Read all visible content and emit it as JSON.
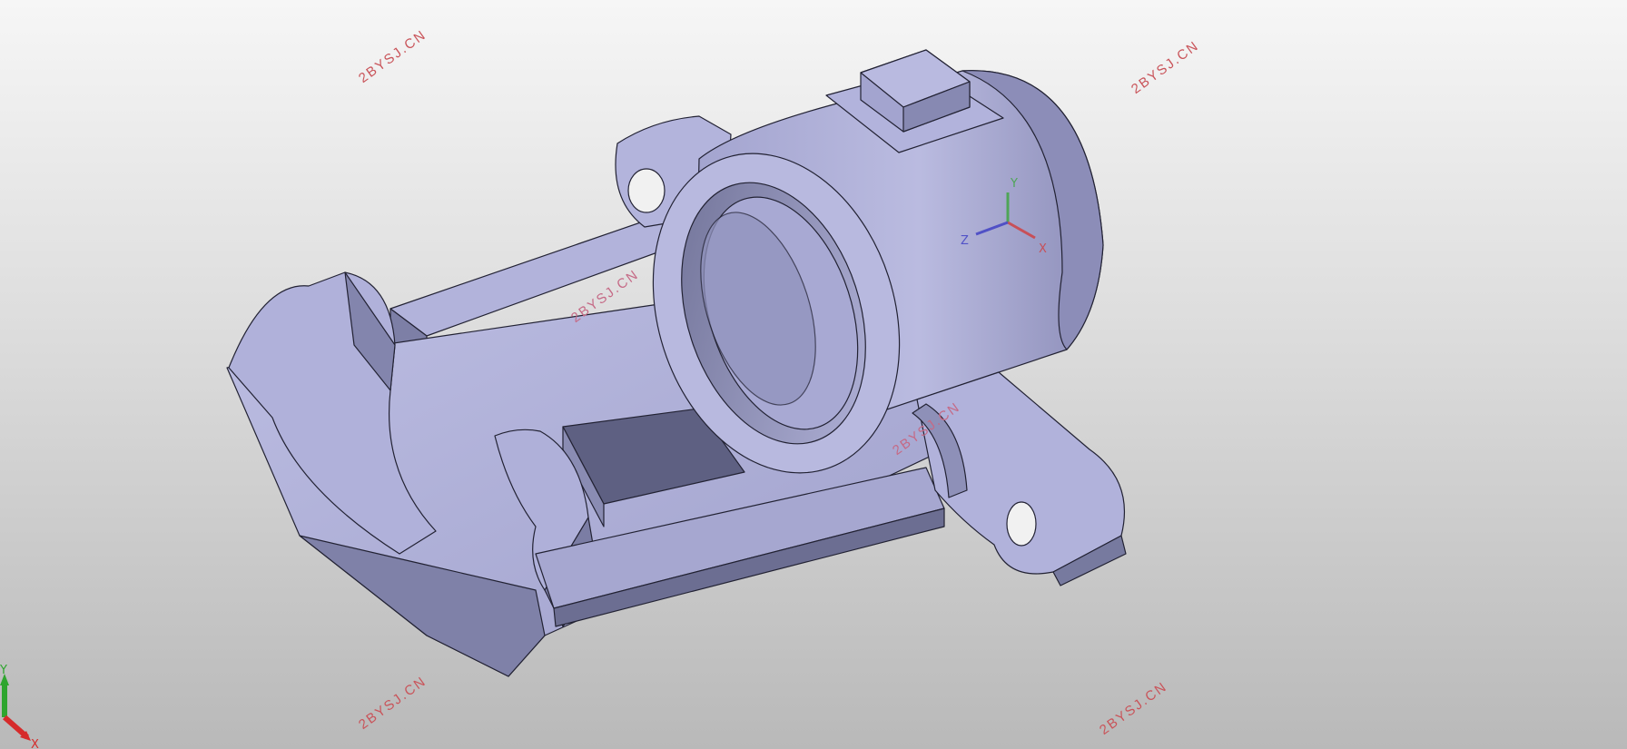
{
  "watermarks": [
    "2BYSJ.CN",
    "2BYSJ.CN",
    "2BYSJ.CN",
    "2BYSJ.CN",
    "2BYSJ.CN",
    "2BYSJ.CN"
  ],
  "triad": {
    "x": "X",
    "y": "Y"
  },
  "model_axes": {
    "x": "X",
    "y": "Y",
    "z": "Z"
  },
  "colors": {
    "part_base": "#a9aad2",
    "part_light": "#b7b8de",
    "part_shadow": "#686a8c",
    "part_edge": "#222233",
    "watermark": "#c9545a",
    "axis_x": "#e03030",
    "axis_y": "#30b030",
    "axis_z": "#3030c8"
  }
}
